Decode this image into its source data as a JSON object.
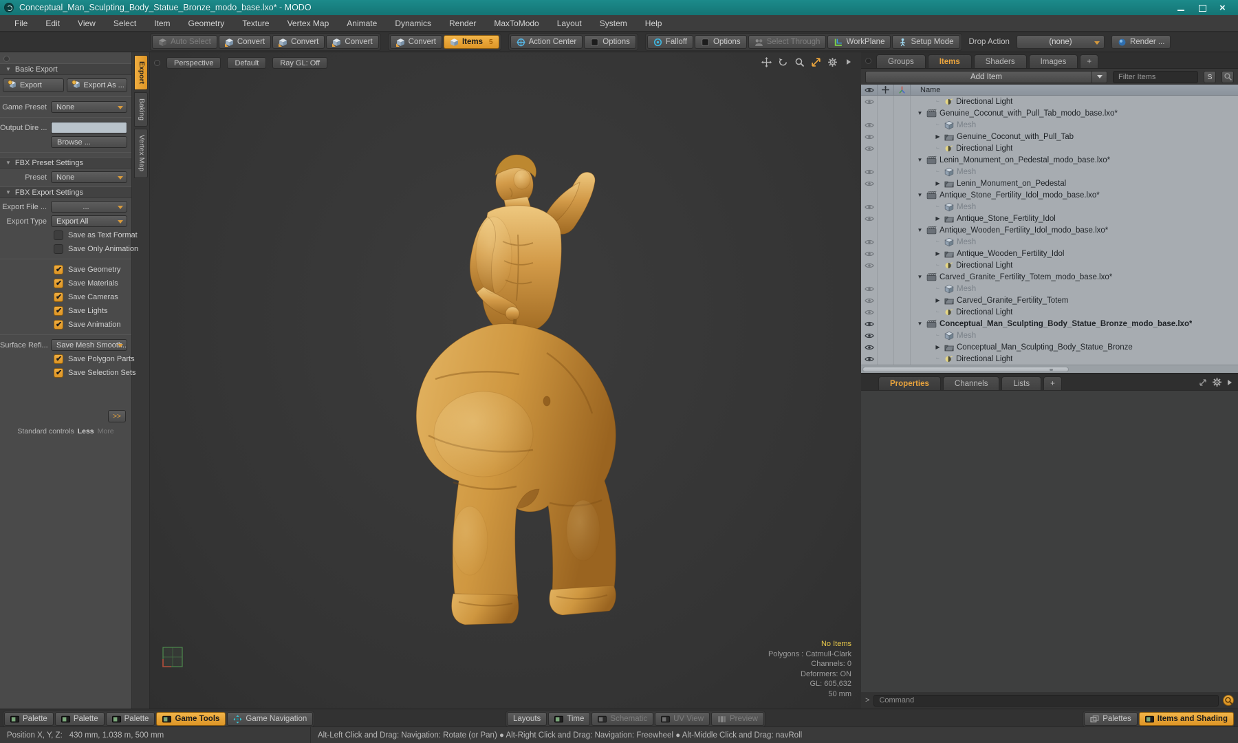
{
  "title_bar": {
    "title": "Conceptual_Man_Sculpting_Body_Statue_Bronze_modo_base.lxo* - MODO"
  },
  "menu_bar": {
    "items": [
      "File",
      "Edit",
      "View",
      "Select",
      "Item",
      "Geometry",
      "Texture",
      "Vertex Map",
      "Animate",
      "Dynamics",
      "Render",
      "MaxToModo",
      "Layout",
      "System",
      "Help"
    ]
  },
  "toolbar": {
    "groups": [
      [
        {
          "label": "Auto Select",
          "icon": "cube-dim",
          "state": "disabled"
        },
        {
          "label": "Convert",
          "icon": "cube-convert",
          "state": "normal"
        },
        {
          "label": "Convert",
          "icon": "cube-convert",
          "state": "normal"
        },
        {
          "label": "Convert",
          "icon": "cube-convert",
          "state": "normal"
        }
      ],
      [
        {
          "label": "Convert",
          "icon": "cube-convert",
          "state": "normal"
        },
        {
          "label": "Items",
          "icon": "cube",
          "state": "active",
          "badge": "5"
        }
      ],
      [
        {
          "label": "Action Center",
          "icon": "action-center",
          "state": "normal"
        },
        {
          "label": "Options",
          "icon": "options-box",
          "state": "normal"
        }
      ],
      [
        {
          "label": "Falloff",
          "icon": "falloff",
          "state": "normal"
        },
        {
          "label": "Options",
          "icon": "options-box",
          "state": "normal"
        },
        {
          "label": "Select Through",
          "icon": "select-through",
          "state": "disabled"
        },
        {
          "label": "WorkPlane",
          "icon": "workplane",
          "state": "normal"
        },
        {
          "label": "Setup Mode",
          "icon": "setup-person",
          "state": "normal"
        }
      ]
    ],
    "drop_action_label": "Drop Action",
    "drop_action_value": "(none)",
    "render_button": {
      "label": "Render ...",
      "icon": "render-sphere"
    }
  },
  "left_panel": {
    "section_basic": "Basic Export",
    "export_button": "Export",
    "export_as_button": "Export As ...",
    "game_preset_label": "Game Preset",
    "game_preset_value": "None",
    "output_dir_label": "Output Dire ...",
    "browse_button": "Browse ...",
    "section_fbx_preset": "FBX Preset Settings",
    "preset_label": "Preset",
    "preset_value": "None",
    "section_fbx_export": "FBX Export Settings",
    "export_file_label": "Export File  ...",
    "export_file_value": "...",
    "export_type_label": "Export Type",
    "export_type_value": "Export All",
    "checkboxes_unchecked": [
      "Save as Text Format",
      "Save Only Animation"
    ],
    "checkboxes_checked": [
      "Save Geometry",
      "Save Materials",
      "Save Cameras",
      "Save Lights",
      "Save Animation"
    ],
    "surface_label": "Surface Refi...",
    "surface_value": "Save Mesh Smooth...",
    "checkboxes_checked2": [
      "Save Polygon Parts",
      "Save Selection Sets"
    ],
    "more_button": ">>",
    "footer_standard": "Standard controls",
    "footer_less": "Less",
    "footer_more": "More"
  },
  "side_tabs": [
    {
      "label": "Export",
      "active": true
    },
    {
      "label": "Baking",
      "active": false
    },
    {
      "label": "Vertex Map",
      "active": false
    }
  ],
  "viewport": {
    "controls": [
      "Perspective",
      "Default",
      "Ray GL: Off"
    ],
    "corner_icons": [
      "move-icon",
      "rotate-icon",
      "zoom-icon",
      "maximize-icon",
      "gear-icon",
      "arrow-icon"
    ],
    "info_lines": [
      "No Items",
      "Polygons : Catmull-Clark",
      "Channels: 0",
      "Deformers: ON",
      "GL: 605,632",
      "50 mm"
    ]
  },
  "right_panel": {
    "tabs": [
      {
        "label": "Groups",
        "active": false
      },
      {
        "label": "Items",
        "active": true
      },
      {
        "label": "Shaders",
        "active": false
      },
      {
        "label": "Images",
        "active": false
      },
      {
        "label": "+",
        "active": false
      }
    ],
    "add_item_label": "Add Item",
    "filter_placeholder": "Filter Items",
    "s_button": "S",
    "name_column": "Name",
    "items": [
      {
        "t": "Directional Light",
        "icon": "light",
        "child": true,
        "eye": "dim",
        "exp": "none",
        "dim": false,
        "bold": false
      },
      {
        "t": "Genuine_Coconut_with_Pull_Tab_modo_base.lxo*",
        "icon": "scene",
        "child": false,
        "eye": "none",
        "exp": "open",
        "dim": false,
        "bold": false
      },
      {
        "t": "Mesh",
        "icon": "mesh",
        "child": true,
        "eye": "dim",
        "exp": "none",
        "dim": true,
        "bold": false
      },
      {
        "t": "Genuine_Coconut_with_Pull_Tab",
        "icon": "folder",
        "child": true,
        "eye": "dim",
        "exp": "closed",
        "dim": false,
        "bold": false
      },
      {
        "t": "Directional Light",
        "icon": "light",
        "child": true,
        "eye": "dim",
        "exp": "none",
        "dim": false,
        "bold": false
      },
      {
        "t": "Lenin_Monument_on_Pedestal_modo_base.lxo*",
        "icon": "scene",
        "child": false,
        "eye": "none",
        "exp": "open",
        "dim": false,
        "bold": false
      },
      {
        "t": "Mesh",
        "icon": "mesh",
        "child": true,
        "eye": "dim",
        "exp": "none",
        "dim": true,
        "bold": false
      },
      {
        "t": "Lenin_Monument_on_Pedestal",
        "icon": "folder",
        "child": true,
        "eye": "dim",
        "exp": "closed",
        "dim": false,
        "bold": false
      },
      {
        "t": "Antique_Stone_Fertility_Idol_modo_base.lxo*",
        "icon": "scene",
        "child": false,
        "eye": "none",
        "exp": "open",
        "dim": false,
        "bold": false
      },
      {
        "t": "Mesh",
        "icon": "mesh",
        "child": true,
        "eye": "dim",
        "exp": "none",
        "dim": true,
        "bold": false
      },
      {
        "t": "Antique_Stone_Fertility_Idol",
        "icon": "folder",
        "child": true,
        "eye": "dim",
        "exp": "closed",
        "dim": false,
        "bold": false
      },
      {
        "t": "Antique_Wooden_Fertility_Idol_modo_base.lxo*",
        "icon": "scene",
        "child": false,
        "eye": "none",
        "exp": "open",
        "dim": false,
        "bold": false
      },
      {
        "t": "Mesh",
        "icon": "mesh",
        "child": true,
        "eye": "dim",
        "exp": "none",
        "dim": true,
        "bold": false
      },
      {
        "t": "Antique_Wooden_Fertility_Idol",
        "icon": "folder",
        "child": true,
        "eye": "dim",
        "exp": "closed",
        "dim": false,
        "bold": false
      },
      {
        "t": "Directional Light",
        "icon": "light",
        "child": true,
        "eye": "dim",
        "exp": "none",
        "dim": false,
        "bold": false
      },
      {
        "t": "Carved_Granite_Fertility_Totem_modo_base.lxo*",
        "icon": "scene",
        "child": false,
        "eye": "none",
        "exp": "open",
        "dim": false,
        "bold": false
      },
      {
        "t": "Mesh",
        "icon": "mesh",
        "child": true,
        "eye": "dim",
        "exp": "none",
        "dim": true,
        "bold": false
      },
      {
        "t": "Carved_Granite_Fertility_Totem",
        "icon": "folder",
        "child": true,
        "eye": "dim",
        "exp": "closed",
        "dim": false,
        "bold": false
      },
      {
        "t": "Directional Light",
        "icon": "light",
        "child": true,
        "eye": "dim",
        "exp": "none",
        "dim": false,
        "bold": false
      },
      {
        "t": "Conceptual_Man_Sculpting_Body_Statue_Bronze_modo_base.lxo*",
        "icon": "scene",
        "child": false,
        "eye": "strong",
        "exp": "open",
        "dim": false,
        "bold": true
      },
      {
        "t": "Mesh",
        "icon": "mesh",
        "child": true,
        "eye": "strong",
        "exp": "none",
        "dim": true,
        "bold": false
      },
      {
        "t": "Conceptual_Man_Sculpting_Body_Statue_Bronze",
        "icon": "folder",
        "child": true,
        "eye": "strong",
        "exp": "closed",
        "dim": false,
        "bold": false
      },
      {
        "t": "Directional Light",
        "icon": "light",
        "child": true,
        "eye": "strong",
        "exp": "none",
        "dim": false,
        "bold": false
      }
    ],
    "bottom_tabs": [
      {
        "label": "Properties",
        "active": true
      },
      {
        "label": "Channels",
        "active": false
      },
      {
        "label": "Lists",
        "active": false
      },
      {
        "label": "+",
        "active": false
      }
    ],
    "command_prompt": ">",
    "command_placeholder": "Command"
  },
  "bottom_toolbar": {
    "left": [
      {
        "label": "Palette",
        "icon": "swatch-green",
        "state": "normal"
      },
      {
        "label": "Palette",
        "icon": "swatch-green",
        "state": "normal"
      },
      {
        "label": "Palette",
        "icon": "swatch-green",
        "state": "normal"
      },
      {
        "label": "Game Tools",
        "icon": "swatch-green",
        "state": "active"
      },
      {
        "label": "Game Navigation",
        "icon": "game-nav",
        "state": "normal"
      }
    ],
    "middle": [
      {
        "label": "Layouts",
        "icon": "none",
        "state": "normal"
      },
      {
        "label": "Time",
        "icon": "swatch-green",
        "state": "normal"
      },
      {
        "label": "Schematic",
        "icon": "swatch-gray",
        "state": "disabled"
      },
      {
        "label": "UV View",
        "icon": "swatch-gray",
        "state": "disabled"
      },
      {
        "label": "Preview",
        "icon": "bars",
        "state": "disabled"
      }
    ],
    "right": [
      {
        "label": "Palettes",
        "icon": "windows",
        "state": "normal"
      },
      {
        "label": "Items and Shading",
        "icon": "swatch-green",
        "state": "active"
      }
    ]
  },
  "status_bar": {
    "position_label": "Position X, Y, Z:",
    "position_value": "430 mm, 1.038 m, 500 mm",
    "hint_text": "Alt-Left Click and Drag: Navigation: Rotate (or Pan)  ●  Alt-Right Click and Drag: Navigation: Freewheel  ●  Alt-Middle Click and Drag: navRoll"
  },
  "colors": {
    "titlebar_teal": "#17807f",
    "accent_orange": "#e8a33d",
    "list_bg": "#a7acb1",
    "statue_gold": "#d29a48",
    "info_yellow": "#e8c84a"
  }
}
